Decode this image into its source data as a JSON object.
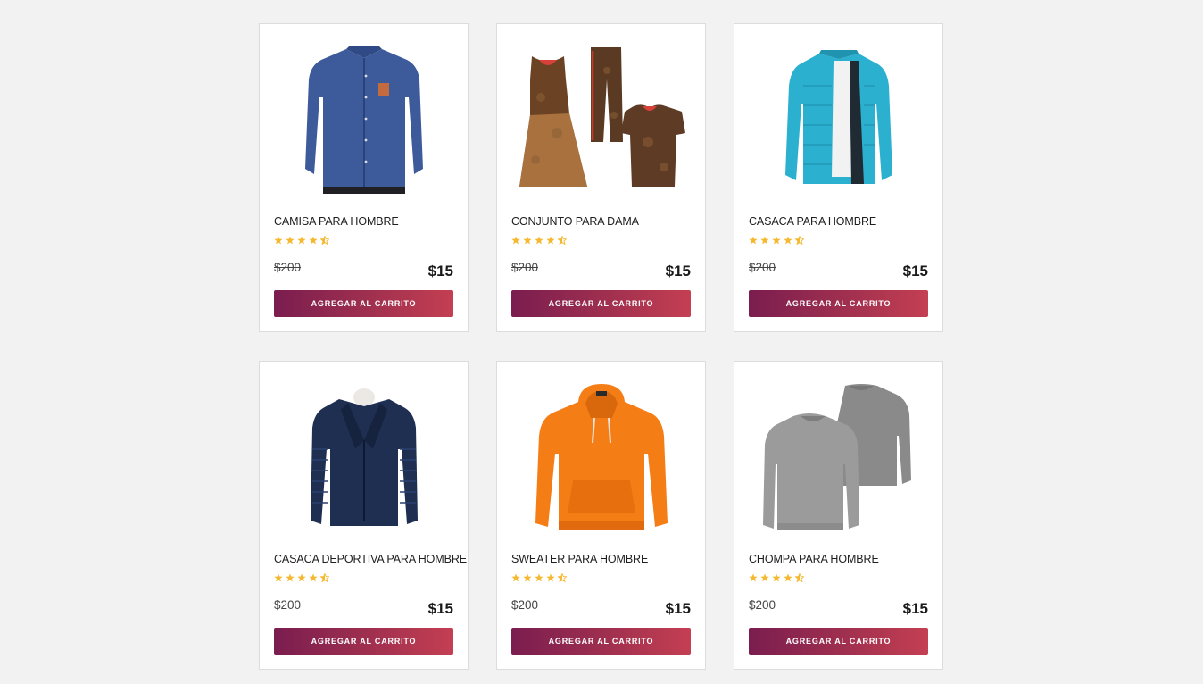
{
  "colors": {
    "page_background": "#f3f2f3",
    "card_background": "#ffffff",
    "button_gradient_start": "#7a1d4f",
    "button_gradient_end": "#c43f52",
    "star": "#f5b82e"
  },
  "products": [
    {
      "name": "CAMISA PARA HOMBRE",
      "image_icon": "blue-shirt-image",
      "rating": 4.5,
      "old_price": "$200",
      "price": "$15",
      "button_label": "AGREGAR AL CARRITO"
    },
    {
      "name": "CONJUNTO PARA DAMA",
      "image_icon": "womens-set-image",
      "rating": 4.5,
      "old_price": "$200",
      "price": "$15",
      "button_label": "AGREGAR AL CARRITO"
    },
    {
      "name": "CASACA PARA HOMBRE",
      "image_icon": "cyan-jacket-image",
      "rating": 4.5,
      "old_price": "$200",
      "price": "$15",
      "button_label": "AGREGAR AL CARRITO"
    },
    {
      "name": "CASACA DEPORTIVA PARA HOMBRE",
      "image_icon": "navy-jacket-image",
      "rating": 4.5,
      "old_price": "$200",
      "price": "$15",
      "button_label": "AGREGAR AL CARRITO"
    },
    {
      "name": "SWEATER PARA HOMBRE",
      "image_icon": "orange-hoodie-image",
      "rating": 4.5,
      "old_price": "$200",
      "price": "$15",
      "button_label": "AGREGAR AL CARRITO"
    },
    {
      "name": "CHOMPA PARA HOMBRE",
      "image_icon": "gray-sweater-image",
      "rating": 4.5,
      "old_price": "$200",
      "price": "$15",
      "button_label": "AGREGAR AL CARRITO"
    }
  ]
}
